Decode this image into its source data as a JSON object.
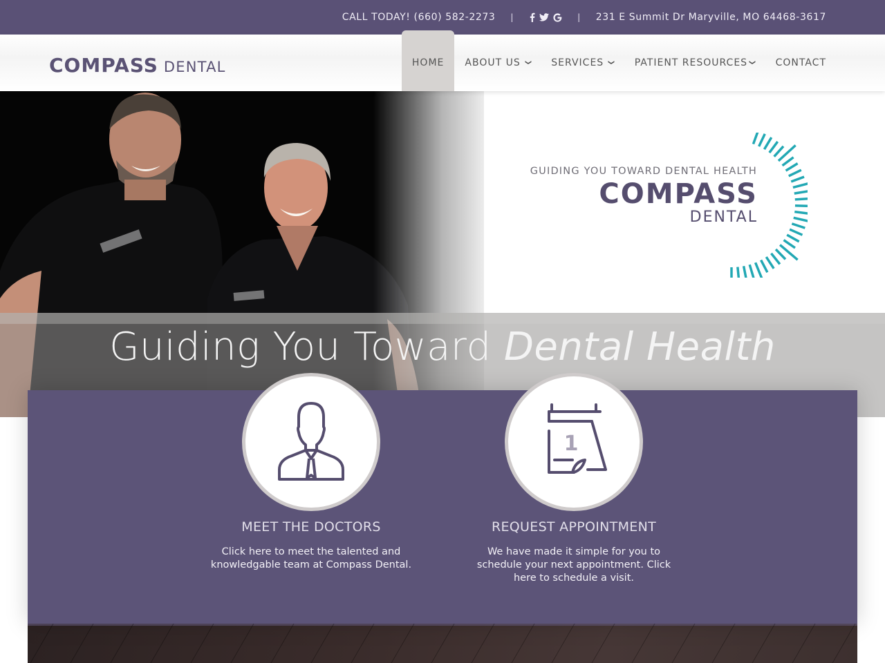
{
  "topbar": {
    "call_label": "CALL TODAY! (660) 582-2273",
    "separator": "|",
    "social": [
      {
        "name": "facebook",
        "glyph": "f"
      },
      {
        "name": "twitter",
        "glyph": "twitter-bird"
      },
      {
        "name": "google",
        "glyph": "G"
      }
    ],
    "address": "231 E Summit Dr Maryville, MO 64468-3617"
  },
  "header": {
    "logo_main": "COMPASS",
    "logo_sub": "DENTAL",
    "nav": [
      {
        "label": "HOME",
        "active": true,
        "dropdown": false
      },
      {
        "label": "ABOUT US",
        "active": false,
        "dropdown": true
      },
      {
        "label": "SERVICES",
        "active": false,
        "dropdown": true
      },
      {
        "label": "PATIENT RESOURCES",
        "active": false,
        "dropdown": true
      },
      {
        "label": "CONTACT",
        "active": false,
        "dropdown": false
      }
    ],
    "chevron": "⌄"
  },
  "hero": {
    "logo_tagline": "GUIDING YOU TOWARD DENTAL HEALTH",
    "logo_main": "COMPASS",
    "logo_sub": "DENTAL",
    "headline_regular": "Guiding You Toward ",
    "headline_italic": "Dental Health",
    "photo_alt": "Two dentists in black scrubs"
  },
  "features": [
    {
      "icon": "doctor-icon",
      "title": "MEET THE DOCTORS",
      "text": "Click here to meet the talented and knowledgable team at Compass Dental."
    },
    {
      "icon": "calendar-icon",
      "calendar_number": "1",
      "title": "REQUEST APPOINTMENT",
      "text": "We have made it simple for you to schedule your next appointment. Click here to schedule a visit."
    }
  ],
  "colors": {
    "brand_purple": "#5c5478",
    "topbar_purple": "#5a5176",
    "accent_teal": "#22a8b4",
    "nav_active_bg": "#d6d3d1"
  }
}
